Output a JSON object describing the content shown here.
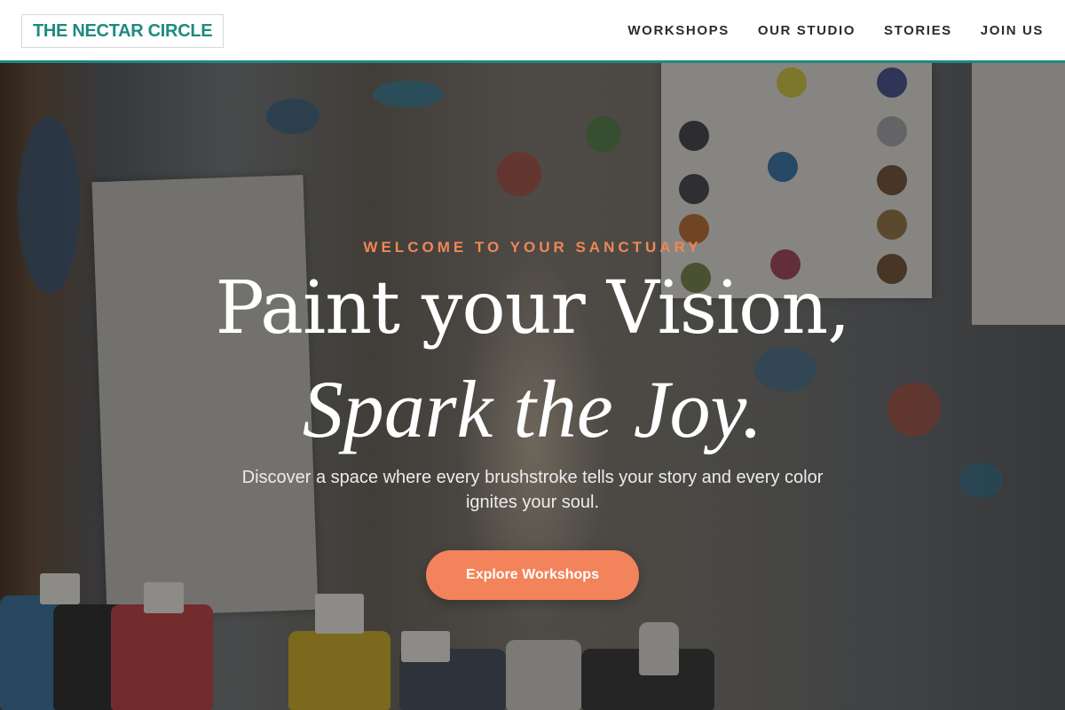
{
  "header": {
    "logo_text": "THE NECTAR CIRCLE",
    "nav": [
      {
        "label": "WORKSHOPS"
      },
      {
        "label": "OUR STUDIO"
      },
      {
        "label": "STORIES"
      },
      {
        "label": "JOIN US"
      }
    ]
  },
  "hero": {
    "eyebrow": "WELCOME TO YOUR SANCTUARY",
    "headline_line1": "Paint your Vision,",
    "headline_line2": "Spark the Joy.",
    "subtext": "Discover a space where every brushstroke tells your story and every color ignites your soul.",
    "cta_label": "Explore Workshops"
  },
  "colors": {
    "brand_teal": "#1e8a80",
    "accent_orange": "#f2835a",
    "eyebrow_orange": "#ee8757"
  }
}
